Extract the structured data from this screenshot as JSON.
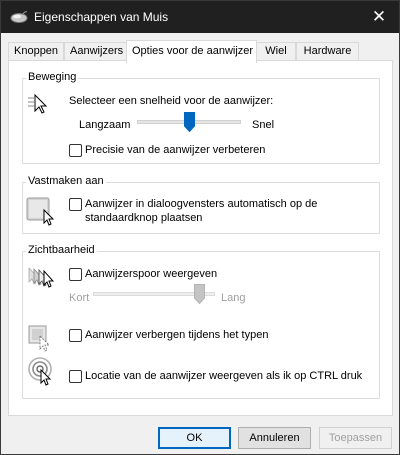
{
  "window": {
    "title": "Eigenschappen van Muis",
    "close_glyph": "✕"
  },
  "tabs": [
    {
      "label": "Knoppen"
    },
    {
      "label": "Aanwijzers"
    },
    {
      "label": "Opties voor de aanwijzer",
      "active": true
    },
    {
      "label": "Wiel"
    },
    {
      "label": "Hardware"
    }
  ],
  "motion": {
    "title": "Beweging",
    "prompt": "Selecteer een snelheid voor de aanwijzer:",
    "slow_label": "Langzaam",
    "fast_label": "Snel",
    "speed_level": 0.5,
    "precision_label": "Precisie van de aanwijzer verbeteren",
    "precision_checked": false
  },
  "snap": {
    "title": "Vastmaken aan",
    "snap_label_line1": "Aanwijzer in dialoogvensters automatisch op de",
    "snap_label_line2": "standaardknop plaatsen",
    "snap_checked": false
  },
  "visibility": {
    "title": "Zichtbaarheid",
    "trails_label": "Aanwijzerspoor weergeven",
    "trails_checked": false,
    "short_label": "Kort",
    "long_label": "Lang",
    "trail_level": 1.0,
    "hide_label": "Aanwijzer verbergen tijdens het typen",
    "hide_checked": false,
    "ctrl_label": "Locatie van de aanwijzer weergeven als ik op CTRL druk",
    "ctrl_checked": false
  },
  "buttons": {
    "ok": "OK",
    "cancel": "Annuleren",
    "apply": "Toepassen"
  },
  "colors": {
    "accent": "#0067c0",
    "titlebar": "#202020"
  }
}
